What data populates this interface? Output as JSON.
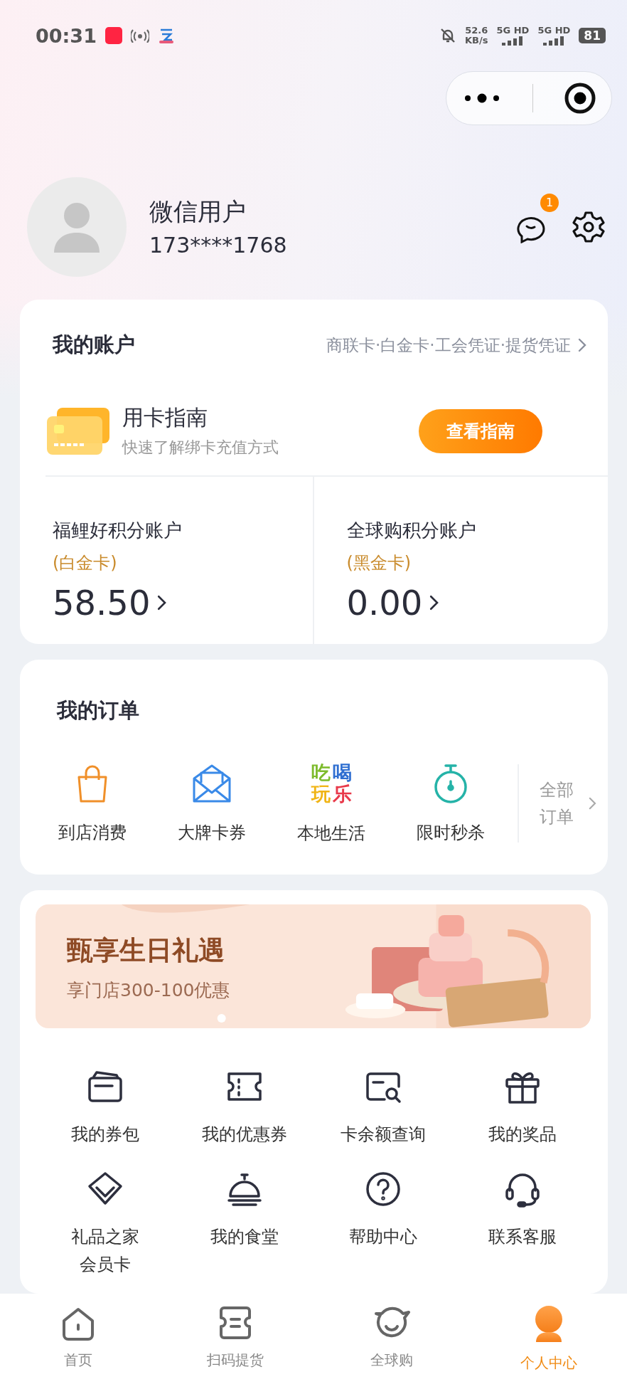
{
  "status_bar": {
    "time": "00:31",
    "speed": "52.6",
    "speed_unit": "KB/s",
    "networks": [
      "5G HD",
      "5G HD"
    ],
    "battery": "81"
  },
  "header": {
    "name": "微信用户",
    "phone": "173****1768",
    "message_badge": "1"
  },
  "account": {
    "title": "我的账户",
    "card_types": "商联卡·白金卡·工会凭证·提货凭证",
    "guide": {
      "title": "用卡指南",
      "subtitle": "快速了解绑卡充值方式",
      "button": "查看指南"
    },
    "points": [
      {
        "name": "福鲤好积分账户",
        "tier": "(白金卡)",
        "value": "58.50"
      },
      {
        "name": "全球购积分账户",
        "tier": "(黑金卡)",
        "value": "0.00"
      }
    ]
  },
  "orders": {
    "title": "我的订单",
    "items": [
      {
        "kind": "bag",
        "label": "到店消费"
      },
      {
        "kind": "envelope",
        "label": "大牌卡券"
      },
      {
        "kind": "logo",
        "logo": "吃喝玩乐",
        "label": "本地生活"
      },
      {
        "kind": "timer",
        "label": "限时秒杀"
      }
    ],
    "all_label": "全部订单"
  },
  "banner": {
    "title": "甄享生日礼遇",
    "subtitle": "享门店300-100优惠"
  },
  "services": [
    {
      "kind": "wallet",
      "label": "我的券包"
    },
    {
      "kind": "ticket",
      "label": "我的优惠券"
    },
    {
      "kind": "card-search",
      "label": "卡余额查询"
    },
    {
      "kind": "gift",
      "label": "我的奖品"
    },
    {
      "kind": "diamond",
      "label": "礼品之家会员卡"
    },
    {
      "kind": "cloche",
      "label": "我的食堂"
    },
    {
      "kind": "help",
      "label": "帮助中心"
    },
    {
      "kind": "headset",
      "label": "联系客服"
    }
  ],
  "tabs": [
    {
      "kind": "home",
      "label": "首页",
      "selected": false
    },
    {
      "kind": "scan",
      "label": "扫码提货",
      "selected": false
    },
    {
      "kind": "face",
      "label": "全球购",
      "selected": false
    },
    {
      "kind": "person",
      "label": "个人中心",
      "selected": true
    }
  ]
}
